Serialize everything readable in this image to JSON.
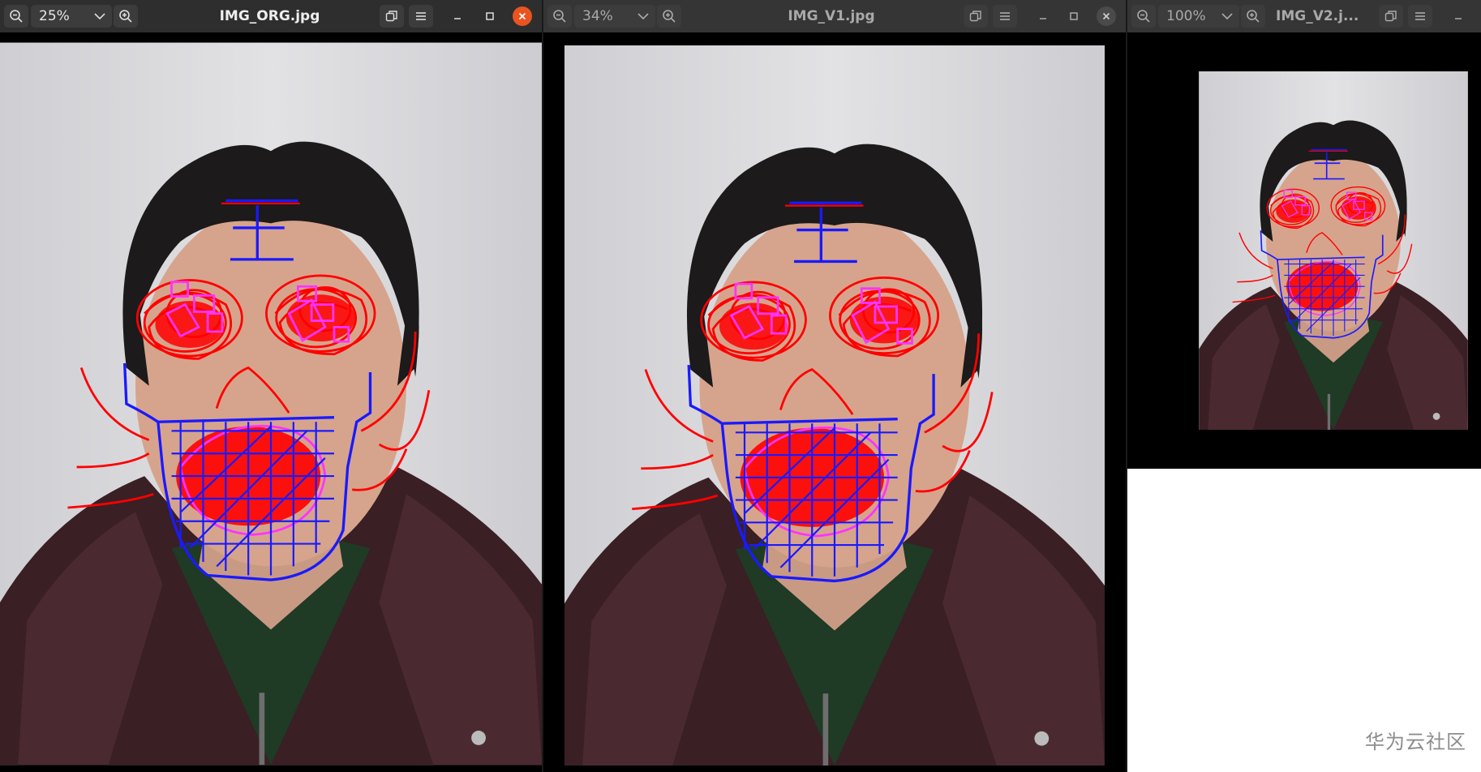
{
  "windows": [
    {
      "title": "IMG_ORG.jpg",
      "zoom": "25%",
      "active": true
    },
    {
      "title": "IMG_V1.jpg",
      "zoom": "34%",
      "active": false
    },
    {
      "title": "IMG_V2.j...",
      "zoom": "100%",
      "active": false
    }
  ],
  "icons": {
    "zoom_out": "zoom-out-icon",
    "zoom_in": "zoom-in-icon",
    "dropdown": "chevron-down-icon",
    "restore": "restore-view-icon",
    "menu": "hamburger-menu-icon",
    "minimize": "minimize-icon",
    "maximize": "maximize-icon",
    "close": "close-icon"
  },
  "colors": {
    "titlebar": "#2e2e2e",
    "close_active": "#e95420",
    "mark_red": "#ff0000",
    "mark_blue": "#1a1aff",
    "mark_magenta": "#ff33ff"
  },
  "watermark": "华为云社区"
}
